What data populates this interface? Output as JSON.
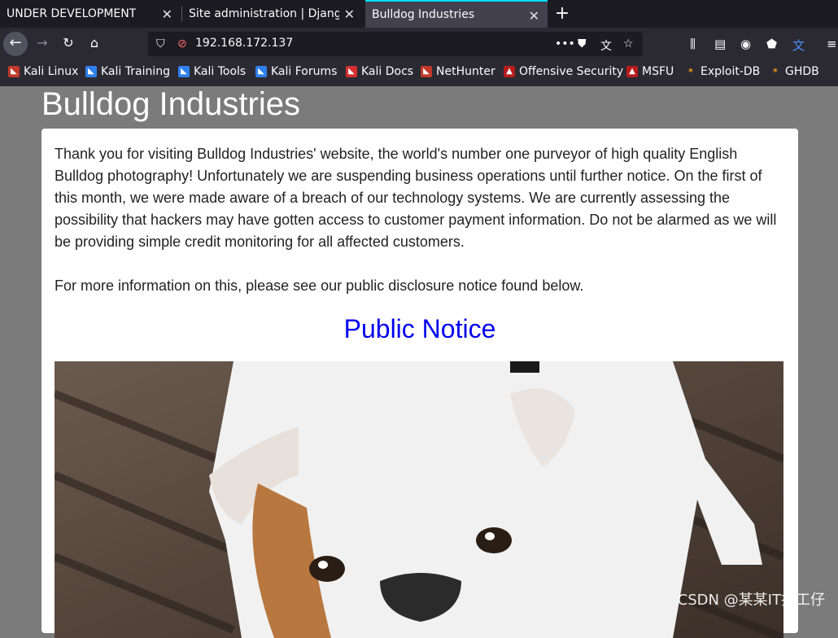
{
  "tabs": [
    {
      "title": "UNDER DEVELOPMENT",
      "active": false
    },
    {
      "title": "Site administration | Django",
      "active": false
    },
    {
      "title": "Bulldog Industries",
      "active": true
    }
  ],
  "address": {
    "url": "192.168.172.137"
  },
  "bookmarks": [
    {
      "label": "Kali Linux",
      "icon": "kali-icon"
    },
    {
      "label": "Kali Training",
      "icon": "kali-training-icon"
    },
    {
      "label": "Kali Tools",
      "icon": "kali-tools-icon"
    },
    {
      "label": "Kali Forums",
      "icon": "kali-forums-icon"
    },
    {
      "label": "Kali Docs",
      "icon": "kali-docs-icon"
    },
    {
      "label": "NetHunter",
      "icon": "nethunter-icon"
    },
    {
      "label": "Offensive Security",
      "icon": "offsec-icon"
    },
    {
      "label": "MSFU",
      "icon": "msfu-icon"
    },
    {
      "label": "Exploit-DB",
      "icon": "exploitdb-icon"
    },
    {
      "label": "GHDB",
      "icon": "ghdb-icon"
    }
  ],
  "page": {
    "title": "Bulldog Industries",
    "paragraph1": "Thank you for visiting Bulldog Industries' website, the world's number one purveyor of high quality English Bulldog photography! Unfortunately we are suspending business operations until further notice. On the first of this month, we were made aware of a breach of our technology systems. We are currently assessing the possibility that hackers may have gotten access to customer payment information. Do not be alarmed as we will be providing simple credit monitoring for all affected customers.",
    "paragraph2": "For more information on this, please see our public disclosure notice found below.",
    "notice_link": "Public Notice"
  },
  "watermark": "CSDN @某某IT打工仔",
  "colors": {
    "accent": "#00ddff",
    "link": "#0000ee",
    "page_bg": "#7b7b7b"
  }
}
